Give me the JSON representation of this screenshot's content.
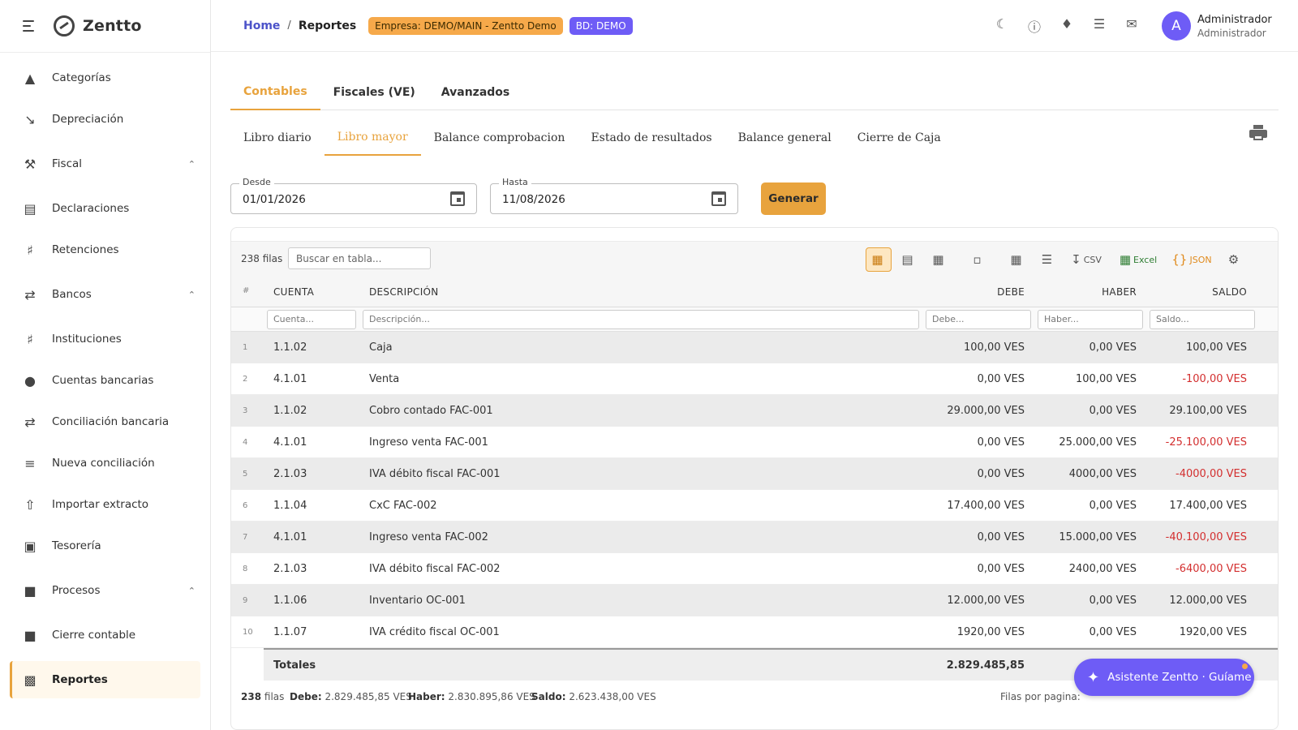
{
  "app": {
    "name": "Zentto"
  },
  "sidebar": {
    "items": [
      {
        "label": "Categorías",
        "icon": "shapes-icon"
      },
      {
        "label": "Depreciación",
        "icon": "trending-down-icon"
      },
      {
        "label": "Fiscal",
        "icon": "gavel-icon",
        "expanded": true
      },
      {
        "label": "Declaraciones",
        "icon": "document-icon"
      },
      {
        "label": "Retenciones",
        "icon": "bank-icon"
      },
      {
        "label": "Bancos",
        "icon": "transfer-icon",
        "expanded": true
      },
      {
        "label": "Instituciones",
        "icon": "bank-icon"
      },
      {
        "label": "Cuentas bancarias",
        "icon": "piggy-bank-icon"
      },
      {
        "label": "Conciliación bancaria",
        "icon": "transfer-icon"
      },
      {
        "label": "Nueva conciliación",
        "icon": "checklist-icon"
      },
      {
        "label": "Importar extracto",
        "icon": "upload-file-icon"
      },
      {
        "label": "Tesorería",
        "icon": "wallet-icon"
      },
      {
        "label": "Procesos",
        "icon": "lock-icon",
        "expanded": true
      },
      {
        "label": "Cierre contable",
        "icon": "lock-icon"
      },
      {
        "label": "Reportes",
        "icon": "bar-chart-icon",
        "active": true
      }
    ]
  },
  "header": {
    "breadcrumb_home": "Home",
    "breadcrumb_sep": "/",
    "breadcrumb_current": "Reportes",
    "badge_empresa": "Empresa: DEMO/MAIN - Zentto Demo",
    "badge_bd": "BD: DEMO",
    "user_initial": "A",
    "user_name": "Administrador",
    "user_role": "Administrador"
  },
  "tabs": [
    {
      "label": "Contables",
      "active": true
    },
    {
      "label": "Fiscales (VE)"
    },
    {
      "label": "Avanzados"
    }
  ],
  "subtabs": [
    {
      "label": "Libro diario"
    },
    {
      "label": "Libro mayor",
      "active": true
    },
    {
      "label": "Balance comprobacion"
    },
    {
      "label": "Estado de resultados"
    },
    {
      "label": "Balance general"
    },
    {
      "label": "Cierre de Caja"
    }
  ],
  "filters": {
    "desde_label": "Desde",
    "desde_value": "01/01/2026",
    "hasta_label": "Hasta",
    "hasta_value": "11/08/2026",
    "generate_label": "Generar"
  },
  "table": {
    "rows_count": "238 filas",
    "search_placeholder": "Buscar en tabla...",
    "tools": {
      "csv": "CSV",
      "excel": "Excel",
      "json": "JSON"
    },
    "columns": {
      "idx": "#",
      "cuenta": "CUENTA",
      "descripcion": "DESCRIPCIÓN",
      "debe": "DEBE",
      "haber": "HABER",
      "saldo": "SALDO"
    },
    "filter_placeholders": {
      "cuenta": "Cuenta...",
      "descripcion": "Descripción...",
      "debe": "Debe...",
      "haber": "Haber...",
      "saldo": "Saldo..."
    },
    "rows": [
      {
        "n": "1",
        "cuenta": "1.1.02",
        "descripcion": "Caja",
        "debe": "100,00 VES",
        "haber": "0,00 VES",
        "saldo": "100,00 VES",
        "neg": false
      },
      {
        "n": "2",
        "cuenta": "4.1.01",
        "descripcion": "Venta",
        "debe": "0,00 VES",
        "haber": "100,00 VES",
        "saldo": "-100,00 VES",
        "neg": true
      },
      {
        "n": "3",
        "cuenta": "1.1.02",
        "descripcion": "Cobro contado FAC-001",
        "debe": "29.000,00 VES",
        "haber": "0,00 VES",
        "saldo": "29.100,00 VES",
        "neg": false
      },
      {
        "n": "4",
        "cuenta": "4.1.01",
        "descripcion": "Ingreso venta FAC-001",
        "debe": "0,00 VES",
        "haber": "25.000,00 VES",
        "saldo": "-25.100,00 VES",
        "neg": true
      },
      {
        "n": "5",
        "cuenta": "2.1.03",
        "descripcion": "IVA débito fiscal FAC-001",
        "debe": "0,00 VES",
        "haber": "4000,00 VES",
        "saldo": "-4000,00 VES",
        "neg": true
      },
      {
        "n": "6",
        "cuenta": "1.1.04",
        "descripcion": "CxC FAC-002",
        "debe": "17.400,00 VES",
        "haber": "0,00 VES",
        "saldo": "17.400,00 VES",
        "neg": false
      },
      {
        "n": "7",
        "cuenta": "4.1.01",
        "descripcion": "Ingreso venta FAC-002",
        "debe": "0,00 VES",
        "haber": "15.000,00 VES",
        "saldo": "-40.100,00 VES",
        "neg": true
      },
      {
        "n": "8",
        "cuenta": "2.1.03",
        "descripcion": "IVA débito fiscal FAC-002",
        "debe": "0,00 VES",
        "haber": "2400,00 VES",
        "saldo": "-6400,00 VES",
        "neg": true
      },
      {
        "n": "9",
        "cuenta": "1.1.06",
        "descripcion": "Inventario OC-001",
        "debe": "12.000,00 VES",
        "haber": "0,00 VES",
        "saldo": "12.000,00 VES",
        "neg": false
      },
      {
        "n": "10",
        "cuenta": "1.1.07",
        "descripcion": "IVA crédito fiscal OC-001",
        "debe": "1920,00 VES",
        "haber": "0,00 VES",
        "saldo": "1920,00 VES",
        "neg": false
      }
    ],
    "totals": {
      "label": "Totales",
      "debe": "2.829.485,85"
    },
    "footer": {
      "count_num": "238",
      "count_word": "filas",
      "debe_label": "Debe:",
      "debe_value": "2.829.485,85 VES",
      "haber_label": "Haber:",
      "haber_value": "2.830.895,86 VES",
      "saldo_label": "Saldo:",
      "saldo_value": "2.623.438,00 VES",
      "per_page_label": "Filas por pagina:"
    }
  },
  "assistant": {
    "label": "Asistente Zentto · Guíame"
  },
  "colors": {
    "accent": "#e8a33d",
    "brand": "#6e5cf6",
    "negative": "#d32f2f",
    "link": "#4c53c9"
  }
}
